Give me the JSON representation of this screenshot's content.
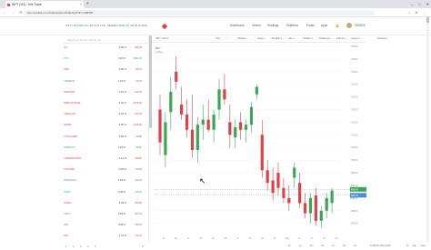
{
  "browser": {
    "tab_title": "INFY (110) - Kite Trade",
    "new_tab": "+",
    "window_buttons": [
      "–",
      "□",
      "✕"
    ],
    "nav_icons": "← → ⟳",
    "url": "kite.zerodha.com/chart/web/tvc/NSE-EQ/INFY/408065",
    "extensions": "☆ ⚙ ⋮"
  },
  "header": {
    "indices": [
      {
        "name": "NIFTY 50",
        "value": "10904.35",
        "change": "+18.75 (0.17%)"
      },
      {
        "name": "SENSEX",
        "value": "36836.90",
        "change": "+50.99 (0.14%)"
      }
    ],
    "menu": [
      "Dashboard",
      "Orders",
      "Holdings",
      "Positions",
      "Funds",
      "Apps"
    ],
    "user": "ZD0678"
  },
  "watchlist": {
    "search_placeholder": "Search eg: infy bse, nifty fut, etc",
    "items": [
      {
        "name": "ITC",
        "change": "",
        "pct": "-0.55 %",
        "price": "286.40",
        "dir": "dn"
      },
      {
        "name": "TCS",
        "change": "",
        "pct": "0.29 %",
        "price": "2024.20",
        "dir": "up"
      },
      {
        "name": "PNB",
        "change": "",
        "pct": "-0.56 %",
        "price": "88.75",
        "dir": "dn"
      },
      {
        "name": "YESBANK",
        "change": "",
        "pct": "1.22 %",
        "price": "99.00",
        "dir": "up"
      },
      {
        "name": "GEPSTAR",
        "change": "",
        "pct": "-1.16 %",
        "price": "142.20",
        "dir": "dn"
      },
      {
        "name": "IDBIFCSTR ME",
        "change": "",
        "pct": "-2.02 %",
        "price": "4675.00",
        "dir": "dn"
      },
      {
        "name": "CEMCLAR",
        "change": "",
        "pct": "-0.33 %",
        "price": "244.30",
        "dir": "dn"
      },
      {
        "name": "NVIDB",
        "change": "",
        "pct": "-2.55 %",
        "price": "1445.00",
        "dir": "dn"
      },
      {
        "name": "LTFTIGUIRE",
        "change": "",
        "pct": "-0.99 %",
        "price": "35.80",
        "dir": "dn"
      },
      {
        "name": "STREILITY",
        "change": "",
        "pct": "0.24 %",
        "price": "46.50",
        "dir": "up"
      },
      {
        "name": "TWRSMOTORS",
        "change": "",
        "pct": "-1.14 %",
        "price": "235.50",
        "dir": "dn"
      },
      {
        "name": "TATAPWR",
        "change": "",
        "pct": "-0.36 %",
        "price": "69.20",
        "dir": "dn"
      },
      {
        "name": "HINDALPAL",
        "change": "",
        "pct": "1.06 %",
        "price": "236.40",
        "dir": "up"
      },
      {
        "name": "ONGC",
        "change": "",
        "pct": "0.36 %",
        "price": "148.20",
        "dir": "up"
      },
      {
        "name": "JINDAL",
        "change": "",
        "pct": "-0.29 %",
        "price": "168.90",
        "dir": "dn"
      },
      {
        "name": "CIPLA",
        "change": "",
        "pct": "0.63 %",
        "price": "553.25",
        "dir": "up"
      },
      {
        "name": "INFY",
        "change": "",
        "pct": "0.50 %",
        "price": "738.60",
        "dir": "up"
      },
      {
        "name": "INFY",
        "change": "",
        "pct": "-1.73 %",
        "price": "731.10",
        "dir": "dn"
      }
    ],
    "pages": [
      "1",
      "2",
      "3",
      "4",
      "5"
    ]
  },
  "chart_toolbar": {
    "symbol": "INFY (110) ▾",
    "items": [
      "1D ▾",
      "⤢",
      "Display ▾",
      "Apply ▾",
      "Flexible ▾",
      "Adv ▾",
      "Studies ▾",
      "Drawings ▾",
      "Events ▾",
      "Layout ▾",
      "Settings ▾"
    ]
  },
  "legend": {
    "symbol": "INFY",
    "study": "Price"
  },
  "chart_data": {
    "type": "candlestick",
    "candles": [
      {
        "o": 720,
        "h": 726,
        "l": 702,
        "c": 707,
        "bull": false
      },
      {
        "o": 702,
        "h": 719,
        "l": 697,
        "c": 715,
        "bull": true
      },
      {
        "o": 719,
        "h": 733,
        "l": 712,
        "c": 727,
        "bull": true
      },
      {
        "o": 735,
        "h": 741,
        "l": 728,
        "c": 731,
        "bull": false
      },
      {
        "o": 722,
        "h": 729,
        "l": 716,
        "c": 718,
        "bull": false
      },
      {
        "o": 718,
        "h": 724,
        "l": 709,
        "c": 712,
        "bull": false
      },
      {
        "o": 712,
        "h": 726,
        "l": 701,
        "c": 704,
        "bull": false
      },
      {
        "o": 704,
        "h": 717,
        "l": 699,
        "c": 714,
        "bull": true
      },
      {
        "o": 714,
        "h": 722,
        "l": 708,
        "c": 716,
        "bull": true
      },
      {
        "o": 716,
        "h": 724,
        "l": 711,
        "c": 712,
        "bull": false
      },
      {
        "o": 712,
        "h": 720,
        "l": 707,
        "c": 718,
        "bull": true
      },
      {
        "o": 720,
        "h": 732,
        "l": 716,
        "c": 728,
        "bull": true
      },
      {
        "o": 728,
        "h": 734,
        "l": 722,
        "c": 724,
        "bull": false
      },
      {
        "o": 715,
        "h": 722,
        "l": 705,
        "c": 710,
        "bull": false
      },
      {
        "o": 709,
        "h": 716,
        "l": 705,
        "c": 713,
        "bull": true
      },
      {
        "o": 715,
        "h": 719,
        "l": 708,
        "c": 712,
        "bull": false
      },
      {
        "o": 712,
        "h": 716,
        "l": 707,
        "c": 714,
        "bull": true
      },
      {
        "o": 714,
        "h": 723,
        "l": 711,
        "c": 721,
        "bull": true
      },
      {
        "o": 726,
        "h": 730,
        "l": 724,
        "c": 729,
        "bull": true
      },
      {
        "o": 710,
        "h": 716,
        "l": 693,
        "c": 696,
        "bull": false
      },
      {
        "o": 696,
        "h": 700,
        "l": 688,
        "c": 691,
        "bull": false
      },
      {
        "o": 692,
        "h": 697,
        "l": 684,
        "c": 687,
        "bull": false
      },
      {
        "o": 695,
        "h": 699,
        "l": 686,
        "c": 689,
        "bull": false
      },
      {
        "o": 689,
        "h": 693,
        "l": 683,
        "c": 685,
        "bull": false
      },
      {
        "o": 685,
        "h": 690,
        "l": 680,
        "c": 683,
        "bull": false
      },
      {
        "o": 693,
        "h": 699,
        "l": 689,
        "c": 697,
        "bull": true
      },
      {
        "o": 691,
        "h": 695,
        "l": 681,
        "c": 683,
        "bull": false
      },
      {
        "o": 683,
        "h": 687,
        "l": 677,
        "c": 679,
        "bull": false
      },
      {
        "o": 679,
        "h": 687,
        "l": 675,
        "c": 685,
        "bull": true
      },
      {
        "o": 686,
        "h": 689,
        "l": 674,
        "c": 676,
        "bull": false
      },
      {
        "o": 676,
        "h": 682,
        "l": 673,
        "c": 680,
        "bull": true
      },
      {
        "o": 680,
        "h": 687,
        "l": 677,
        "c": 685,
        "bull": true
      },
      {
        "o": 683,
        "h": 689,
        "l": 679,
        "c": 688,
        "bull": true
      }
    ],
    "ylim": [
      672,
      745
    ],
    "y_ticks": [
      "745.00",
      "740.00",
      "735.00",
      "730.00",
      "725.00",
      "720.00",
      "715.00",
      "710.00",
      "705.00",
      "700.00",
      "695.00",
      "690.00",
      "685.00",
      "680.00",
      "675.00"
    ],
    "x_ticks": [
      "21",
      "Apr",
      "8",
      "15",
      "22",
      "29",
      "6",
      "13",
      "20",
      "27",
      "May",
      "10",
      "17",
      "24",
      "Jun"
    ],
    "last_price_labels": [
      "688.45",
      "686.10"
    ]
  },
  "colors": {
    "bull": "#3aa757",
    "bear": "#d9434a",
    "accent": "#e0403f"
  },
  "bottombar": {
    "ranges": [
      "5y",
      "1y",
      "6m",
      "3m",
      "1m",
      "5d",
      "1d"
    ],
    "clock": "12:50:03 (UTC+5:30)",
    "toggles": [
      "%",
      "log",
      "auto"
    ]
  }
}
